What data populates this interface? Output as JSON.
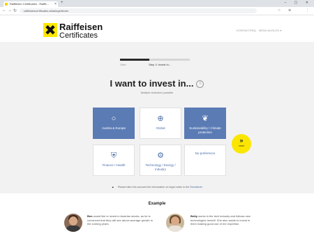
{
  "browser": {
    "tab_title": "Raiffeisen Certificates - Raiffe...",
    "tab_close": "×",
    "new_tab": "+",
    "window_controls": "– ▢ ✕",
    "url": "raiffeisencertificates.at/anlegerfinder",
    "nav_back": "←",
    "nav_forward": "→",
    "nav_reload": "↻",
    "ext_icons": [
      "☆",
      "⊕",
      "⋮"
    ]
  },
  "header": {
    "logo_mark": "✖",
    "logo_line1": "Raiffeisen",
    "logo_line2": "Certificates",
    "link_contact": "KONTAKT/FAQ",
    "link_menu": "MENU AUSLOG ▾"
  },
  "progress": {
    "value": 0.42,
    "start_label": "Start",
    "step_label": "Step 3: Invest in..."
  },
  "question": {
    "title": "I want to invest in...",
    "info_icon": "i",
    "subtitle": "Multiple selection possible"
  },
  "options": [
    {
      "label": "Austria & Europe",
      "icon": "○",
      "selected": true
    },
    {
      "label": "Global",
      "icon": "⊕",
      "selected": false
    },
    {
      "label": "Sustainability / Climate protection",
      "icon": "❦",
      "selected": true
    },
    {
      "label": "Finance / Health",
      "icon": "⛨",
      "selected": false
    },
    {
      "label": "Technology / Energy / Industry",
      "icon": "⚙",
      "selected": false
    },
    {
      "label": "No preference",
      "icon": "",
      "selected": false
    }
  ],
  "next_button": {
    "arrows": "»",
    "label": "next"
  },
  "notice": {
    "icon": "▲",
    "text": "Please take into account the information on legal notes in the",
    "link": "Disclaimer"
  },
  "example": {
    "title": "Example",
    "persons": [
      {
        "name": "Ben",
        "text": "would like to invest in Austrian stocks, as he is convinced that they will see above-average growth in the coming years."
      },
      {
        "name": "Betty",
        "text": "works in the tech industry and follows new technologies herself. She also wants to invest in them making good use of her expertise."
      }
    ]
  },
  "colors": {
    "brand_yellow": "#fee800",
    "selected_blue": "#5b7bb5",
    "text_blue": "#4a6da7"
  }
}
